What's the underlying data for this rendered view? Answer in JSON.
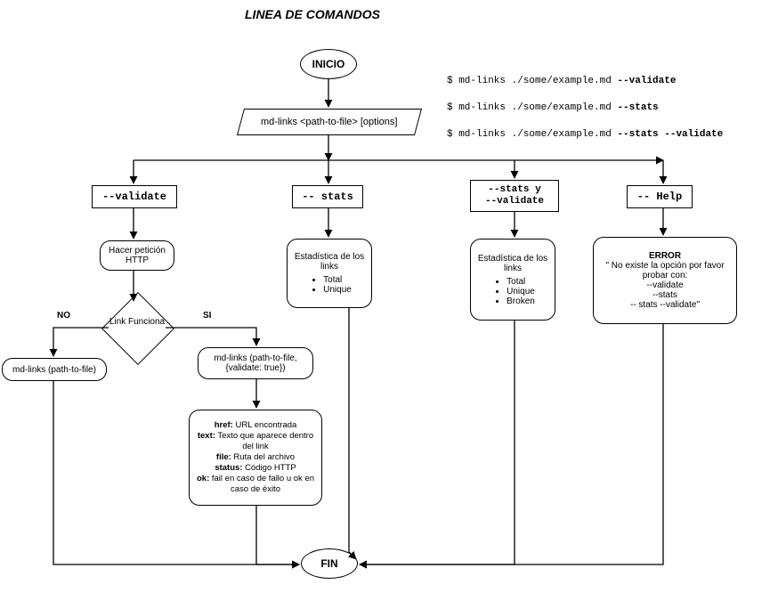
{
  "title": "LINEA DE COMANDOS",
  "examples": [
    {
      "prefix": "$ md-links ./some/example.md ",
      "opt": "--validate"
    },
    {
      "prefix": "$ md-links ./some/example.md ",
      "opt": "--stats"
    },
    {
      "prefix": "$ md-links ./some/example.md ",
      "opt": "--stats --validate"
    }
  ],
  "nodes": {
    "inicio": "INICIO",
    "cmd": "md-links <path-to-file> [options]",
    "options": {
      "validate": "--validate",
      "stats": "-- stats",
      "stats_validate_l1": "--stats y",
      "stats_validate_l2": "--validate",
      "help": "-- Help"
    },
    "validate": {
      "http": "Hacer petición HTTP",
      "decision": "Link Funciona",
      "no_label": "NO",
      "si_label": "SI",
      "no_box": "md-links (path-to-file)",
      "si_box": "md-links (path-to-file, {validate: true})",
      "detail_href_k": "href:",
      "detail_href_v": " URL encontrada",
      "detail_text_k": "text:",
      "detail_text_v": " Texto que aparece dentro del link",
      "detail_file_k": "file:",
      "detail_file_v": " Ruta del archivo",
      "detail_status_k": "status:",
      "detail_status_v": " Código HTTP",
      "detail_ok_k": "ok:",
      "detail_ok_v": " fail en caso de fallo u ok en caso de éxito"
    },
    "stats": {
      "label": "Estadística de los links",
      "items": [
        "Total",
        "Unique"
      ]
    },
    "stats_validate": {
      "label": "Estadística de los links",
      "items": [
        "Total",
        "Unique",
        "Broken"
      ]
    },
    "error": {
      "title": "ERROR",
      "l1": "\" No existe la opción por favor probar con:",
      "l2": "--validate",
      "l3": "--stats",
      "l4": "-- stats --validate\""
    },
    "fin": "FIN"
  },
  "chart_data": {
    "type": "flowchart",
    "title": "LINEA DE COMANDOS",
    "nodes": [
      {
        "id": "inicio",
        "shape": "terminator",
        "label": "INICIO"
      },
      {
        "id": "cmd",
        "shape": "input",
        "label": "md-links <path-to-file> [options]"
      },
      {
        "id": "opt_validate",
        "shape": "process",
        "label": "--validate"
      },
      {
        "id": "opt_stats",
        "shape": "process",
        "label": "-- stats"
      },
      {
        "id": "opt_stats_validate",
        "shape": "process",
        "label": "--stats y --validate"
      },
      {
        "id": "opt_help",
        "shape": "process",
        "label": "-- Help"
      },
      {
        "id": "http",
        "shape": "process-rounded",
        "label": "Hacer petición HTTP"
      },
      {
        "id": "decision",
        "shape": "decision",
        "label": "Link Funciona"
      },
      {
        "id": "no_box",
        "shape": "process-rounded",
        "label": "md-links (path-to-file)"
      },
      {
        "id": "si_box",
        "shape": "process-rounded",
        "label": "md-links (path-to-file, {validate: true})"
      },
      {
        "id": "detail",
        "shape": "process-rounded",
        "label": "href: URL encontrada / text: Texto que aparece dentro del link / file: Ruta del archivo / status: Código HTTP / ok: fail en caso de fallo u ok en caso de éxito"
      },
      {
        "id": "stats_box",
        "shape": "process-rounded",
        "label": "Estadística de los links",
        "items": [
          "Total",
          "Unique"
        ]
      },
      {
        "id": "stats_validate_box",
        "shape": "process-rounded",
        "label": "Estadística de los links",
        "items": [
          "Total",
          "Unique",
          "Broken"
        ]
      },
      {
        "id": "error_box",
        "shape": "process-rounded",
        "label": "ERROR: No existe la opción por favor probar con: --validate / --stats / -- stats --validate"
      },
      {
        "id": "fin",
        "shape": "terminator",
        "label": "FIN"
      }
    ],
    "edges": [
      {
        "from": "inicio",
        "to": "cmd"
      },
      {
        "from": "cmd",
        "to": "opt_validate"
      },
      {
        "from": "cmd",
        "to": "opt_stats"
      },
      {
        "from": "cmd",
        "to": "opt_stats_validate"
      },
      {
        "from": "cmd",
        "to": "opt_help"
      },
      {
        "from": "opt_validate",
        "to": "http"
      },
      {
        "from": "http",
        "to": "decision"
      },
      {
        "from": "decision",
        "to": "no_box",
        "label": "NO"
      },
      {
        "from": "decision",
        "to": "si_box",
        "label": "SI"
      },
      {
        "from": "si_box",
        "to": "detail"
      },
      {
        "from": "opt_stats",
        "to": "stats_box"
      },
      {
        "from": "opt_stats_validate",
        "to": "stats_validate_box"
      },
      {
        "from": "opt_help",
        "to": "error_box"
      },
      {
        "from": "no_box",
        "to": "fin"
      },
      {
        "from": "detail",
        "to": "fin"
      },
      {
        "from": "stats_box",
        "to": "fin"
      },
      {
        "from": "stats_validate_box",
        "to": "fin"
      },
      {
        "from": "error_box",
        "to": "fin"
      }
    ],
    "side_examples": [
      "$ md-links ./some/example.md --validate",
      "$ md-links ./some/example.md --stats",
      "$ md-links ./some/example.md --stats --validate"
    ]
  }
}
